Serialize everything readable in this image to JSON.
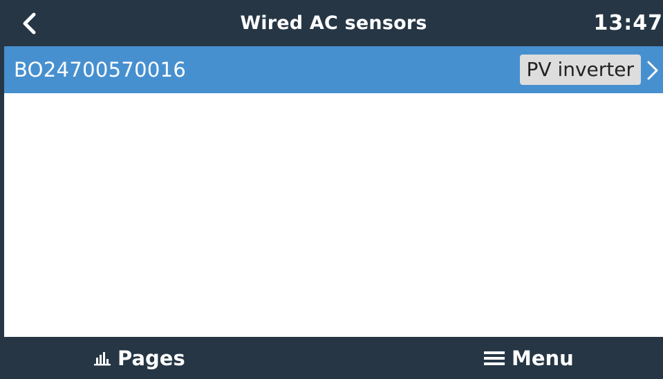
{
  "header": {
    "title": "Wired AC sensors",
    "clock": "13:47",
    "back_icon": "chevron-left-icon"
  },
  "list": {
    "items": [
      {
        "label": "BO24700570016",
        "value": "PV inverter",
        "icon": "chevron-right-icon"
      }
    ]
  },
  "footer": {
    "pages_label": "Pages",
    "pages_icon": "bar-chart-icon",
    "menu_label": "Menu",
    "menu_icon": "hamburger-icon"
  },
  "colors": {
    "header_bg": "#263645",
    "selected_row_bg": "#4790d0",
    "value_badge_bg": "#dddddd",
    "text_light": "#ffffff"
  }
}
